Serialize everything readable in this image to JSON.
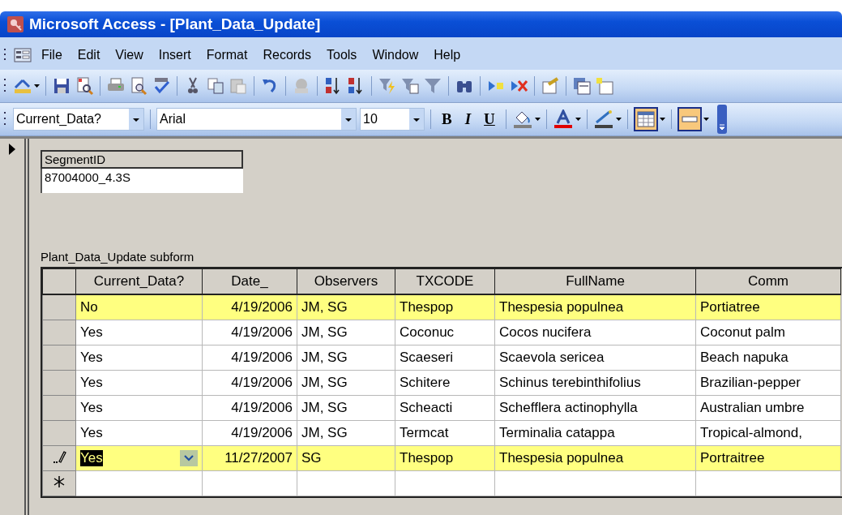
{
  "window": {
    "title": "Microsoft Access - [Plant_Data_Update]"
  },
  "menu": [
    {
      "label": "File"
    },
    {
      "label": "Edit"
    },
    {
      "label": "View"
    },
    {
      "label": "Insert"
    },
    {
      "label": "Format"
    },
    {
      "label": "Records"
    },
    {
      "label": "Tools"
    },
    {
      "label": "Window"
    },
    {
      "label": "Help"
    }
  ],
  "formatting_toolbar": {
    "object_combo": "Current_Data?",
    "font_combo": "Arial",
    "size_combo": "10",
    "style_buttons": [
      {
        "label": "B",
        "kind": "bold"
      },
      {
        "label": "I",
        "kind": "italic"
      },
      {
        "label": "U",
        "kind": "underline"
      }
    ],
    "color_buttons": [
      {
        "kind": "fill",
        "color": "#808080"
      },
      {
        "kind": "font",
        "color": "#e00000"
      },
      {
        "kind": "line",
        "color": "#404040"
      }
    ],
    "toggle_buttons": [
      {
        "kind": "gridlines",
        "selected": true
      },
      {
        "kind": "special-effect",
        "selected": true
      }
    ]
  },
  "form": {
    "segment_label": "SegmentID",
    "segment_value": "87004000_4.3S",
    "subform_label": "Plant_Data_Update subform",
    "columns": [
      "Current_Data?",
      "Date_",
      "Observers",
      "TXCODE",
      "FullName",
      "Comm"
    ],
    "rows": [
      {
        "cells": [
          "No",
          "4/19/2006",
          "JM, SG",
          "Thespop",
          "Thespesia populnea",
          "Portiatree"
        ],
        "highlighted": true,
        "kind": "saved"
      },
      {
        "cells": [
          "Yes",
          "4/19/2006",
          "JM, SG",
          "Coconuc",
          "Cocos nucifera",
          "Coconut palm"
        ],
        "highlighted": false,
        "kind": "saved"
      },
      {
        "cells": [
          "Yes",
          "4/19/2006",
          "JM, SG",
          "Scaeseri",
          "Scaevola sericea",
          "Beach napuka"
        ],
        "highlighted": false,
        "kind": "saved"
      },
      {
        "cells": [
          "Yes",
          "4/19/2006",
          "JM, SG",
          "Schitere",
          "Schinus terebinthifolius",
          "Brazilian-pepper"
        ],
        "highlighted": false,
        "kind": "saved"
      },
      {
        "cells": [
          "Yes",
          "4/19/2006",
          "JM, SG",
          "Scheacti",
          "Schefflera actinophylla",
          "Australian umbre"
        ],
        "highlighted": false,
        "kind": "saved"
      },
      {
        "cells": [
          "Yes",
          "4/19/2006",
          "JM, SG",
          "Termcat",
          "Terminalia catappa",
          "Tropical-almond,"
        ],
        "highlighted": false,
        "kind": "saved"
      },
      {
        "cells": [
          "Yes",
          "11/27/2007",
          "SG",
          "Thespop",
          "Thespesia populnea",
          "Portraitree"
        ],
        "highlighted": true,
        "kind": "editing"
      },
      {
        "cells": [],
        "highlighted": false,
        "kind": "new"
      }
    ]
  }
}
